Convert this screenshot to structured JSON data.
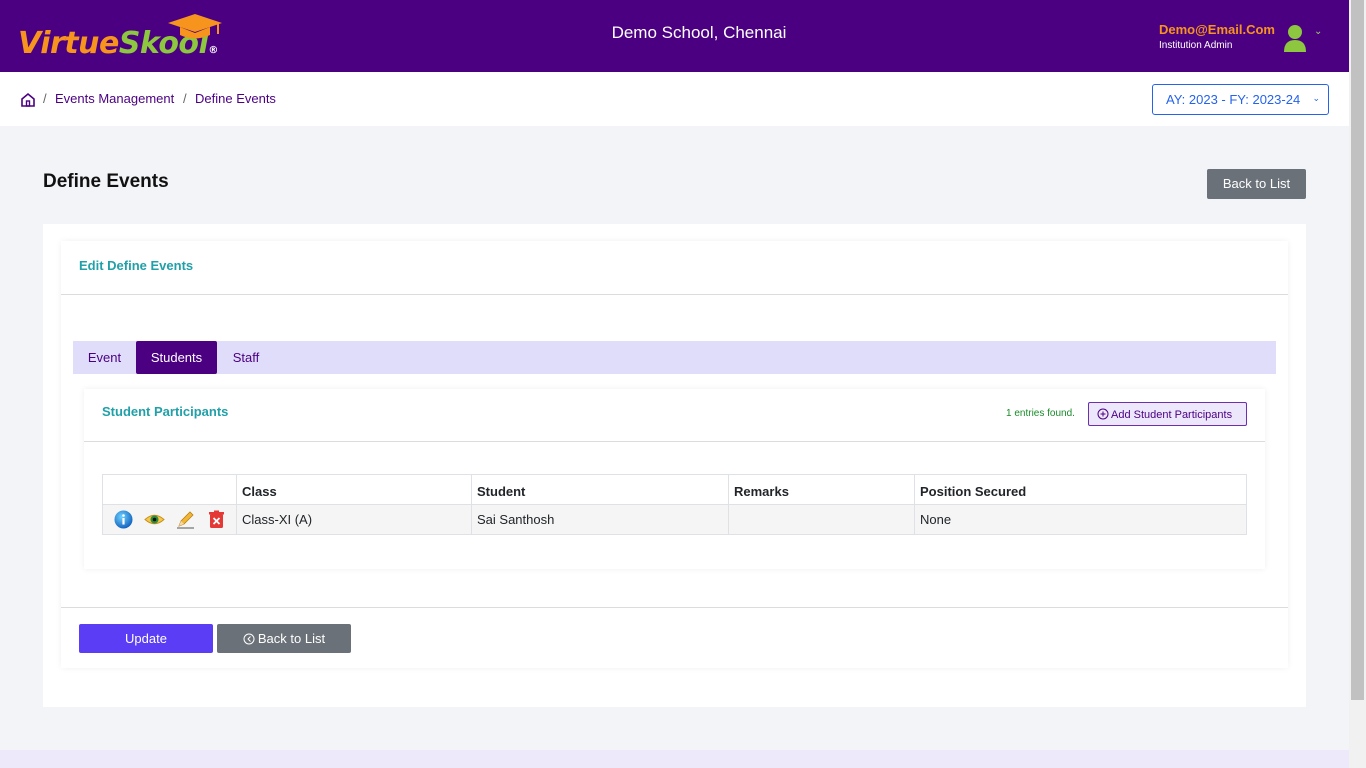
{
  "header": {
    "logo_virtue": "Virtue",
    "logo_skool": "Skool",
    "logo_reg": "®",
    "school": "Demo School, Chennai",
    "email": "Demo@Email.Com",
    "role": "Institution Admin",
    "caret": "⌄"
  },
  "breadcrumb": {
    "sep": "/",
    "items": [
      "Events Management",
      "Define Events"
    ]
  },
  "academic_year": "AY: 2023 - FY: 2023-24",
  "page": {
    "title": "Define Events",
    "back_label": "Back to List"
  },
  "form": {
    "title": "Edit Define Events",
    "tabs": [
      {
        "label": "Event",
        "active": false
      },
      {
        "label": "Students",
        "active": true
      },
      {
        "label": "Staff",
        "active": false
      }
    ],
    "participants": {
      "title": "Student Participants",
      "entries": "1 entries found.",
      "add_label": "Add Student Participants",
      "columns": [
        "",
        "Class",
        "Student",
        "Remarks",
        "Position Secured"
      ],
      "rows": [
        {
          "class": "Class-XI (A)",
          "student": "Sai Santhosh",
          "remarks": "",
          "position": "None"
        }
      ]
    },
    "update_label": "Update",
    "back_label": "Back to List"
  },
  "colors": {
    "header_bg": "#4b0082",
    "accent_teal": "#20a0a8",
    "update_btn": "#5b3df5"
  }
}
